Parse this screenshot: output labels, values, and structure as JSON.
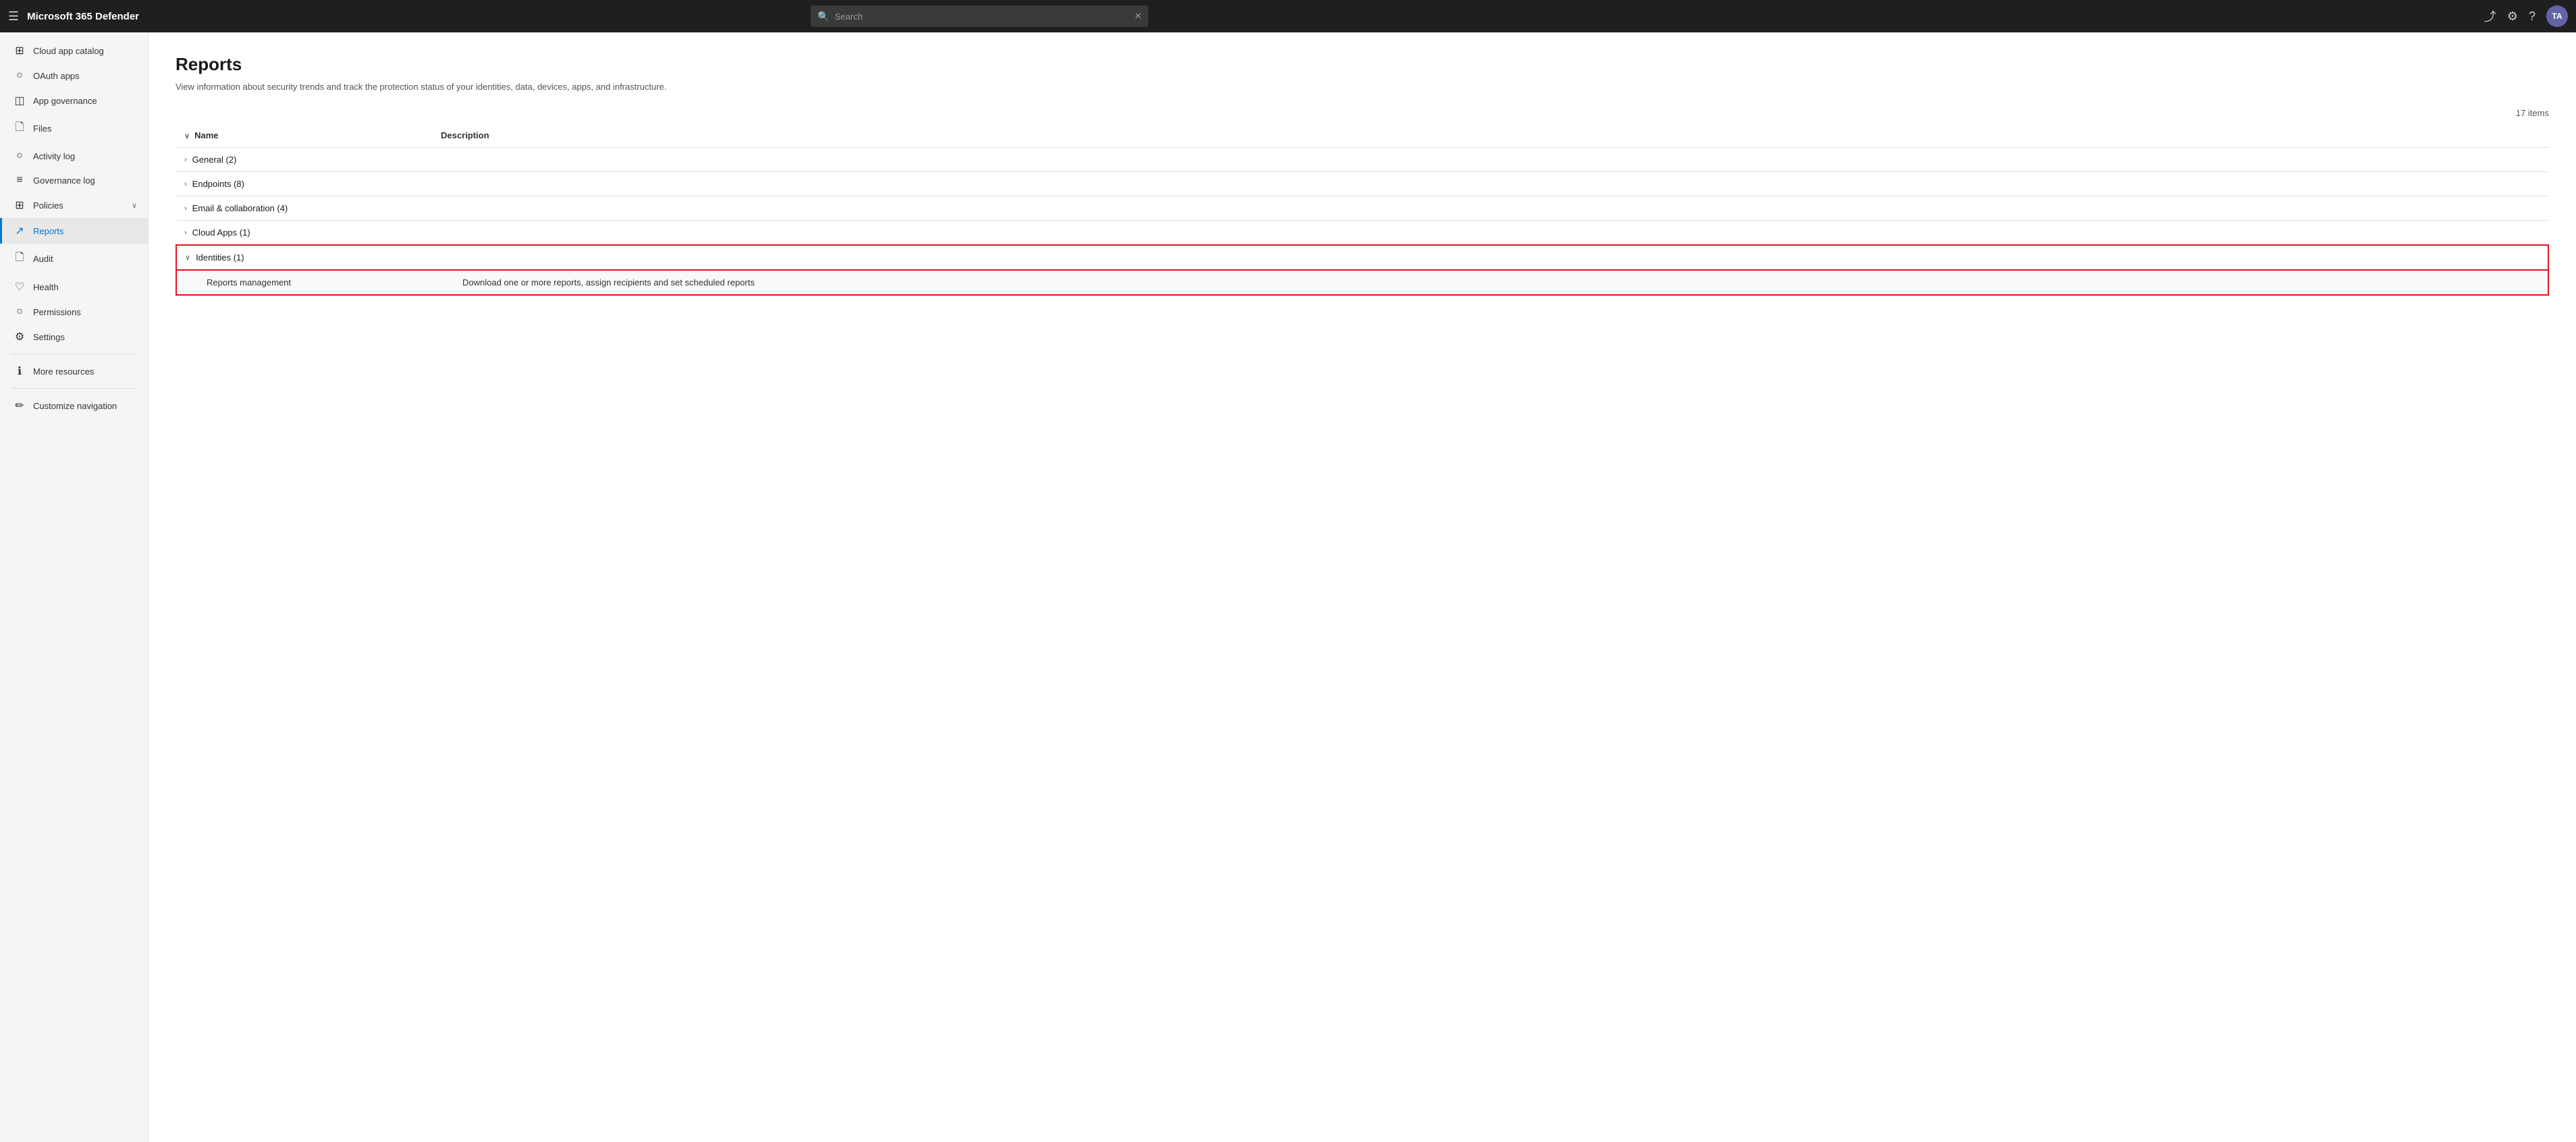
{
  "app": {
    "title": "Microsoft 365 Defender"
  },
  "topbar": {
    "title": "Microsoft 365 Defender",
    "search_placeholder": "Search",
    "avatar_initials": "TA"
  },
  "sidebar": {
    "items": [
      {
        "id": "cloud-app-catalog",
        "label": "Cloud app catalog",
        "icon": "⊞"
      },
      {
        "id": "oauth-apps",
        "label": "OAuth apps",
        "icon": "○"
      },
      {
        "id": "app-governance",
        "label": "App governance",
        "icon": "◫"
      },
      {
        "id": "files",
        "label": "Files",
        "icon": "🗋"
      },
      {
        "id": "activity-log",
        "label": "Activity log",
        "icon": "○"
      },
      {
        "id": "governance-log",
        "label": "Governance log",
        "icon": "≡"
      },
      {
        "id": "policies",
        "label": "Policies",
        "icon": "⊞",
        "has_chevron": true
      },
      {
        "id": "reports",
        "label": "Reports",
        "icon": "↗",
        "active": true
      },
      {
        "id": "audit",
        "label": "Audit",
        "icon": "🗋"
      },
      {
        "id": "health",
        "label": "Health",
        "icon": "♡"
      },
      {
        "id": "permissions",
        "label": "Permissions",
        "icon": "○"
      },
      {
        "id": "settings",
        "label": "Settings",
        "icon": "⚙"
      },
      {
        "id": "more-resources",
        "label": "More resources",
        "icon": "ℹ"
      },
      {
        "id": "customize-navigation",
        "label": "Customize navigation",
        "icon": "✏",
        "is_bottom": true
      }
    ]
  },
  "main": {
    "title": "Reports",
    "subtitle": "View information about security trends and track the protection status of your identities, data, devices, apps, and infrastructure.",
    "items_count": "17 items",
    "columns": {
      "name": "Name",
      "description": "Description"
    },
    "groups": [
      {
        "id": "general",
        "label": "General (2)",
        "expanded": false,
        "highlighted": false,
        "children": []
      },
      {
        "id": "endpoints",
        "label": "Endpoints (8)",
        "expanded": false,
        "highlighted": false,
        "children": []
      },
      {
        "id": "email-collaboration",
        "label": "Email & collaboration (4)",
        "expanded": false,
        "highlighted": false,
        "children": []
      },
      {
        "id": "cloud-apps",
        "label": "Cloud Apps (1)",
        "expanded": false,
        "highlighted": false,
        "children": []
      },
      {
        "id": "identities",
        "label": "Identities (1)",
        "expanded": true,
        "highlighted": true,
        "children": [
          {
            "id": "reports-management",
            "label": "Reports management",
            "description": "Download one or more reports, assign recipients and set scheduled reports"
          }
        ]
      }
    ]
  }
}
